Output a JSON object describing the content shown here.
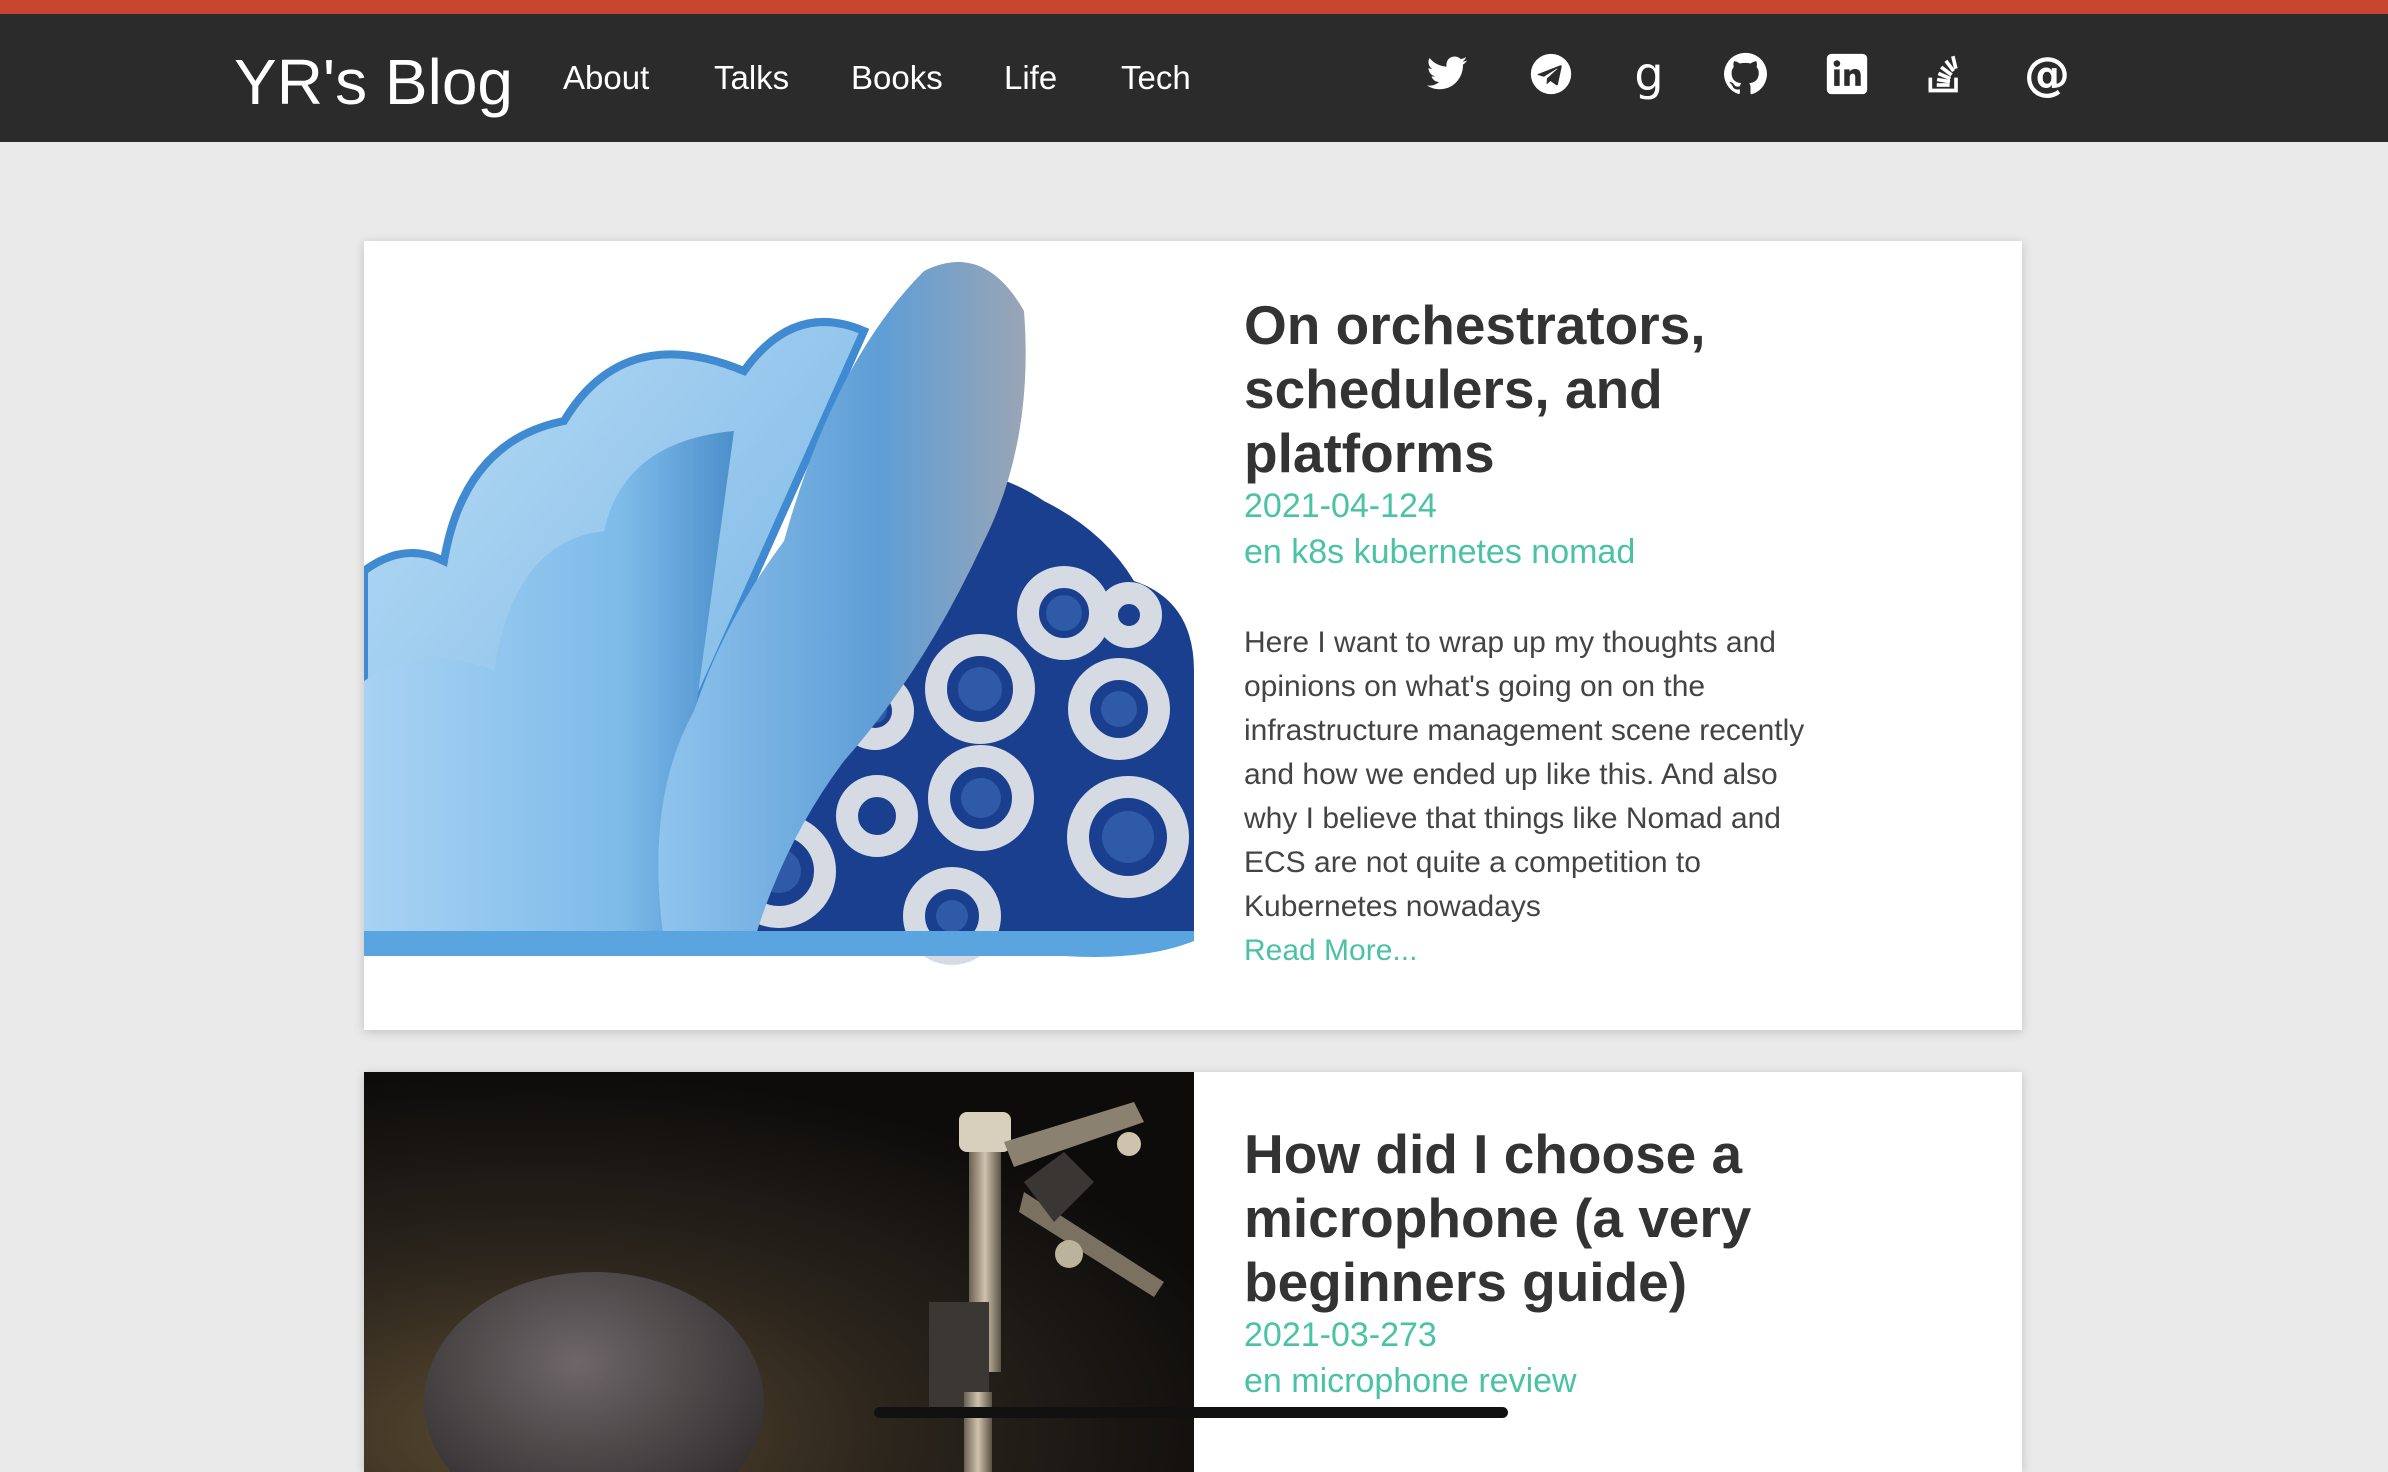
{
  "site": {
    "title": "YR's Blog",
    "accent_color": "#c7452e",
    "navbar_color": "#2b2b2b",
    "link_color": "#4ac2a4"
  },
  "nav": {
    "items": [
      {
        "label": "About"
      },
      {
        "label": "Talks"
      },
      {
        "label": "Books"
      },
      {
        "label": "Life"
      },
      {
        "label": "Tech"
      }
    ]
  },
  "social": [
    {
      "icon": "twitter-icon"
    },
    {
      "icon": "telegram-icon"
    },
    {
      "icon": "goodreads-icon",
      "glyph": "g"
    },
    {
      "icon": "github-icon"
    },
    {
      "icon": "linkedin-icon"
    },
    {
      "icon": "stackoverflow-icon"
    },
    {
      "icon": "email-icon",
      "glyph": "@"
    }
  ],
  "posts": [
    {
      "title_lines": [
        "On orchestrators,",
        "schedulers, and",
        "platforms"
      ],
      "date": "2021-04-124",
      "tags": "en k8s kubernetes nomad",
      "excerpt_lines": [
        "Here I want to wrap up my thoughts and",
        "opinions on what's going on on the",
        "infrastructure management scene recently",
        "and how we ended up like this. And also",
        "why I believe that things like Nomad and",
        "ECS are not quite a competition to",
        "Kubernetes nowadays"
      ],
      "read_more": "Read More...",
      "image": "cloud-gears-illustration"
    },
    {
      "title_lines": [
        "How did I choose a",
        "microphone (a very",
        "beginners guide)"
      ],
      "date": "2021-03-273",
      "tags": "en microphone review",
      "image": "microphone-photo"
    }
  ]
}
